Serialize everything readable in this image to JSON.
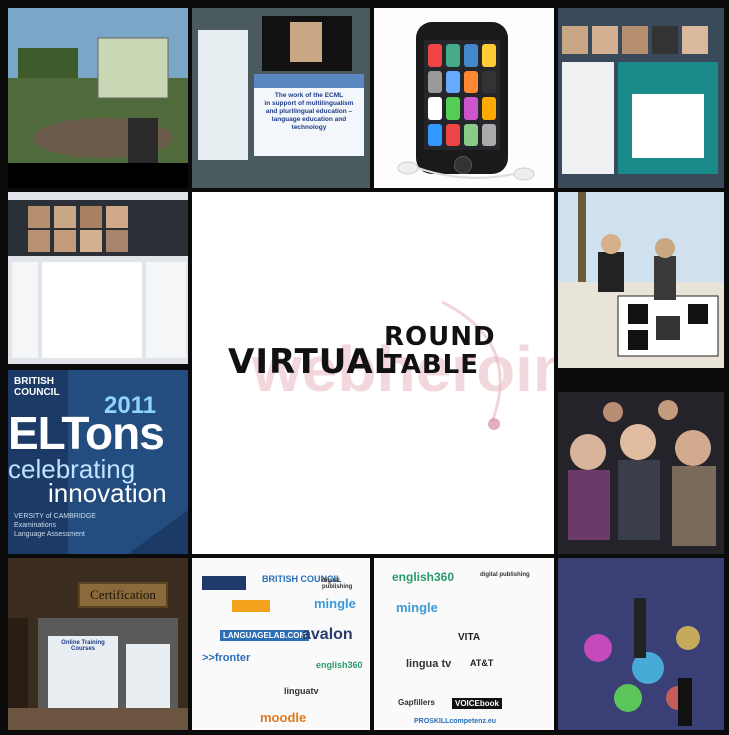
{
  "center": {
    "virtual": "VIRTUAL",
    "round": "ROUND",
    "table": "TABLE",
    "watermark": "webheroin"
  },
  "eltons": {
    "org_line1": "BRITISH",
    "org_line2": "COUNCIL",
    "year": "2011",
    "title": "ELTons",
    "line2": "celebrating",
    "line3": "innovation",
    "footer_line1": "VERSITY of CAMBRIDGE",
    "footer_line2": "Examinations",
    "footer_line3": "Language Assessment"
  },
  "slide": {
    "title_lines": [
      "The work of the ECML",
      "in support of multilingualism",
      "and plurilingual education –",
      "language education and",
      "technology"
    ]
  },
  "certification": {
    "sign": "Certification",
    "board": "Online Training Courses"
  },
  "logos_left": {
    "british_council": "BRITISH COUNCIL",
    "digital": "digital publishing",
    "mingle": "mingle",
    "languagelab": "LANGUAGELAB.COM",
    "avalon": "avalon",
    "fronter": ">>fronter",
    "english360": "english360",
    "linguatv": "linguatv",
    "moodle": "moodle"
  },
  "logos_right": {
    "english360": "english360",
    "digital": "digital publishing",
    "mingle": "mingle",
    "vita": "VITA",
    "linguatv": "lingua tv",
    "att": "AT&T",
    "gapfillers": "Gapfillers",
    "voicebook": "VOICEbook",
    "proskill": "PROSKILLcompetenz.eu"
  },
  "colors": {
    "eltons_bg": "#1b3a66",
    "center_watermark": "#e8b9c2",
    "logo_blue": "#2a6fb8"
  }
}
